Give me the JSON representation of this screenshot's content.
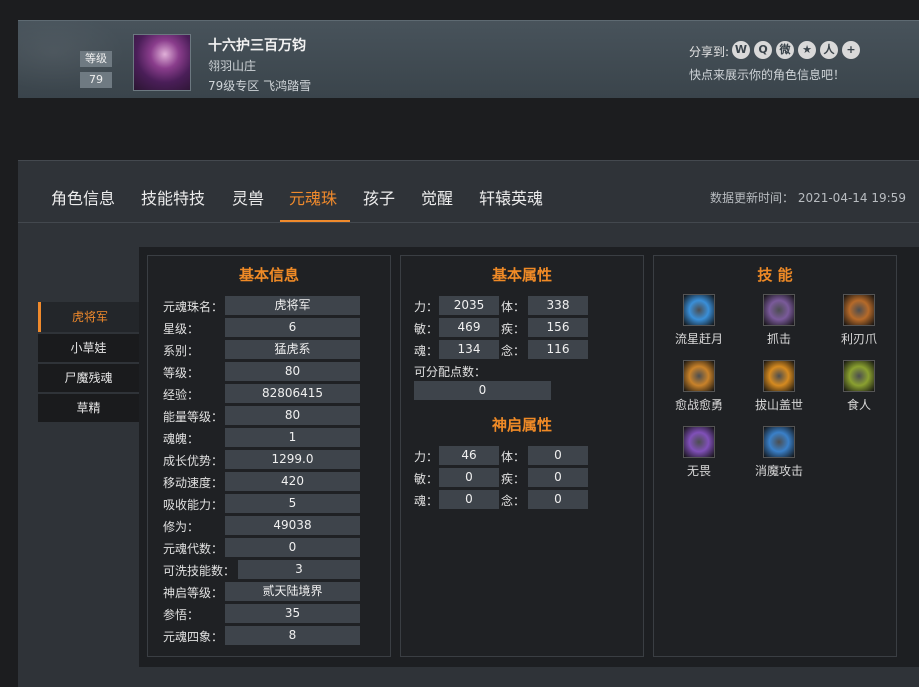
{
  "header": {
    "level_label": "等级",
    "level_value": "79",
    "name": "十六护三百万钧",
    "server": "翎羽山庄",
    "zone": "79级专区 飞鸿踏雪",
    "share_label": "分享到:",
    "share_icons": [
      "wechat-icon",
      "qzone-icon",
      "weibo-icon",
      "star-icon",
      "group-icon",
      "plus-icon"
    ],
    "share_tip": "快点来展示你的角色信息吧！"
  },
  "tabs": [
    "角色信息",
    "技能特技",
    "灵兽",
    "元魂珠",
    "孩子",
    "觉醒",
    "轩辕英魂"
  ],
  "active_tab": "元魂珠",
  "update_time": "数据更新时间： 2021-04-14 19:59",
  "side_items": [
    "虎将军",
    "小草娃",
    "尸魔残魂",
    "草精"
  ],
  "basic_info": {
    "title": "基本信息",
    "rows": [
      {
        "label": "元魂珠名：",
        "value": "虎将军"
      },
      {
        "label": "星级：",
        "value": "6"
      },
      {
        "label": "系别：",
        "value": "猛虎系"
      },
      {
        "label": "等级：",
        "value": "80"
      },
      {
        "label": "经验：",
        "value": "82806415"
      },
      {
        "label": "能量等级：",
        "value": "80"
      },
      {
        "label": "魂魄：",
        "value": "1"
      },
      {
        "label": "成长优势：",
        "value": "1299.0"
      },
      {
        "label": "移动速度：",
        "value": "420"
      },
      {
        "label": "吸收能力：",
        "value": "5"
      },
      {
        "label": "修为：",
        "value": "49038"
      },
      {
        "label": "元魂代数：",
        "value": "0"
      },
      {
        "label": "可洗技能数：",
        "value": "3"
      },
      {
        "label": "神启等级：",
        "value": "贰天陆境界"
      },
      {
        "label": "参悟：",
        "value": "35"
      },
      {
        "label": "元魂四象：",
        "value": "8"
      }
    ]
  },
  "basic_attrs": {
    "title": "基本属性",
    "rows": [
      {
        "l1": "力：",
        "v1": "2035",
        "l2": "体：",
        "v2": "338"
      },
      {
        "l1": "敏：",
        "v1": "469",
        "l2": "疾：",
        "v2": "156"
      },
      {
        "l1": "魂：",
        "v1": "134",
        "l2": "念：",
        "v2": "116"
      }
    ],
    "free_points_label": "可分配点数：",
    "free_points": "0"
  },
  "divine_attrs": {
    "title": "神启属性",
    "rows": [
      {
        "l1": "力：",
        "v1": "46",
        "l2": "体：",
        "v2": "0"
      },
      {
        "l1": "敏：",
        "v1": "0",
        "l2": "疾：",
        "v2": "0"
      },
      {
        "l1": "魂：",
        "v1": "0",
        "l2": "念：",
        "v2": "0"
      }
    ]
  },
  "skills": {
    "title": "技 能",
    "items": [
      {
        "name": "流星赶月",
        "icon": "meteor-icon",
        "color": "#3a8fd8"
      },
      {
        "name": "抓击",
        "icon": "claw-icon",
        "color": "#7a5a9a"
      },
      {
        "name": "利刃爪",
        "icon": "blade-claw-icon",
        "color": "#b56a2a"
      },
      {
        "name": "愈战愈勇",
        "icon": "valor-icon",
        "color": "#c8822a"
      },
      {
        "name": "拔山盖世",
        "icon": "mountain-icon",
        "color": "#d58a20"
      },
      {
        "name": "食人",
        "icon": "devour-icon",
        "color": "#8aa030"
      },
      {
        "name": "无畏",
        "icon": "fearless-icon",
        "color": "#8050b8"
      },
      {
        "name": "消魔攻击",
        "icon": "dispel-icon",
        "color": "#3a80c8"
      }
    ]
  }
}
